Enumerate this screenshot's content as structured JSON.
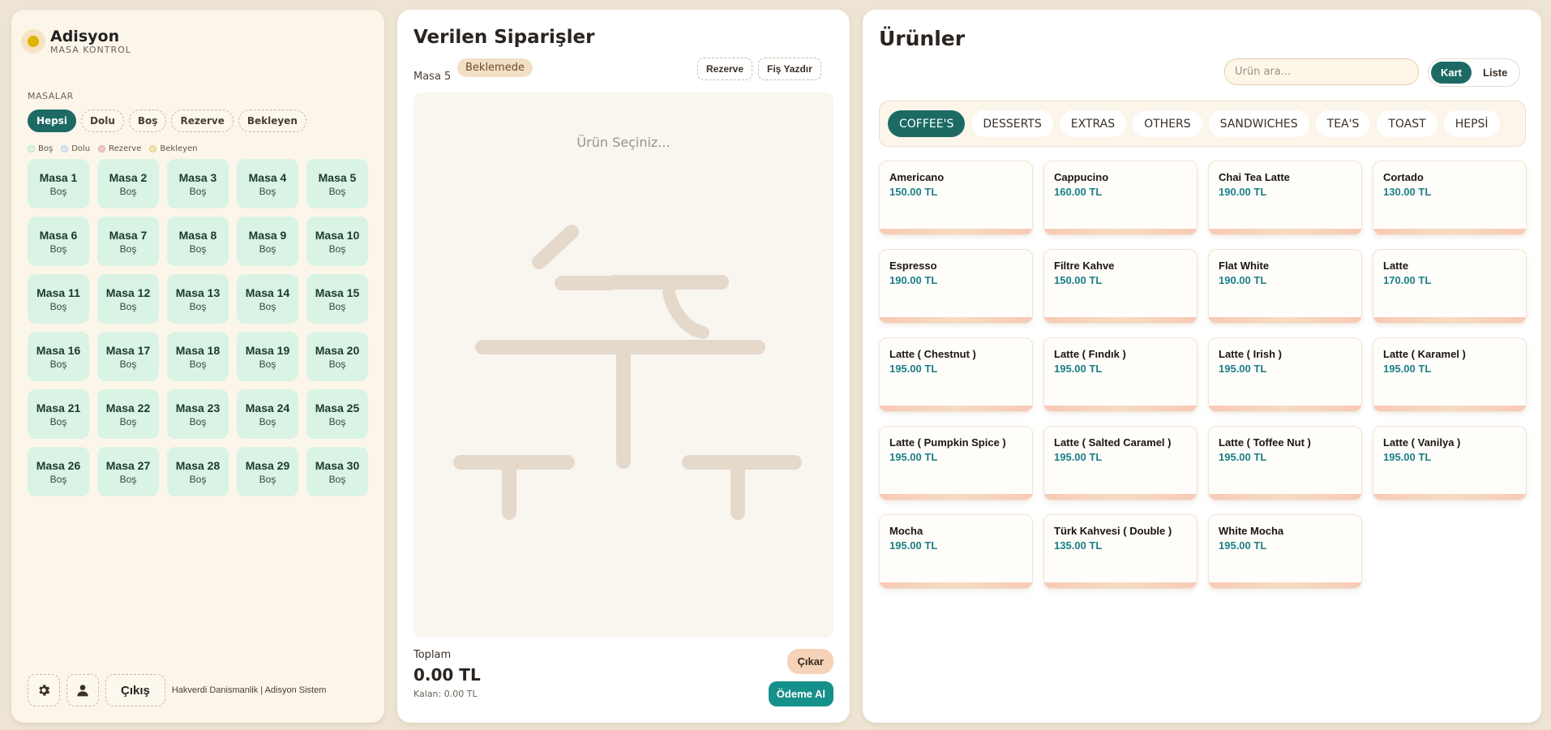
{
  "left": {
    "brand_title": "Adisyon",
    "brand_subtitle": "MASA KONTROL",
    "section_label": "MASALAR",
    "filters": [
      {
        "label": "Hepsi",
        "active": true
      },
      {
        "label": "Dolu",
        "active": false
      },
      {
        "label": "Boş",
        "active": false
      },
      {
        "label": "Rezerve",
        "active": false
      },
      {
        "label": "Bekleyen",
        "active": false
      }
    ],
    "legend": [
      {
        "label": "Boş",
        "color": "#d9f3e4"
      },
      {
        "label": "Dolu",
        "color": "#d6e8fb"
      },
      {
        "label": "Rezerve",
        "color": "#f6c7c7"
      },
      {
        "label": "Bekleyen",
        "color": "#f8e3a8"
      }
    ],
    "tables": [
      {
        "name": "Masa 1",
        "status": "Boş"
      },
      {
        "name": "Masa 2",
        "status": "Boş"
      },
      {
        "name": "Masa 3",
        "status": "Boş"
      },
      {
        "name": "Masa 4",
        "status": "Boş"
      },
      {
        "name": "Masa 5",
        "status": "Boş"
      },
      {
        "name": "Masa 6",
        "status": "Boş"
      },
      {
        "name": "Masa 7",
        "status": "Boş"
      },
      {
        "name": "Masa 8",
        "status": "Boş"
      },
      {
        "name": "Masa 9",
        "status": "Boş"
      },
      {
        "name": "Masa 10",
        "status": "Boş"
      },
      {
        "name": "Masa 11",
        "status": "Boş"
      },
      {
        "name": "Masa 12",
        "status": "Boş"
      },
      {
        "name": "Masa 13",
        "status": "Boş"
      },
      {
        "name": "Masa 14",
        "status": "Boş"
      },
      {
        "name": "Masa 15",
        "status": "Boş"
      },
      {
        "name": "Masa 16",
        "status": "Boş"
      },
      {
        "name": "Masa 17",
        "status": "Boş"
      },
      {
        "name": "Masa 18",
        "status": "Boş"
      },
      {
        "name": "Masa 19",
        "status": "Boş"
      },
      {
        "name": "Masa 20",
        "status": "Boş"
      },
      {
        "name": "Masa 21",
        "status": "Boş"
      },
      {
        "name": "Masa 22",
        "status": "Boş"
      },
      {
        "name": "Masa 23",
        "status": "Boş"
      },
      {
        "name": "Masa 24",
        "status": "Boş"
      },
      {
        "name": "Masa 25",
        "status": "Boş"
      },
      {
        "name": "Masa 26",
        "status": "Boş"
      },
      {
        "name": "Masa 27",
        "status": "Boş"
      },
      {
        "name": "Masa 28",
        "status": "Boş"
      },
      {
        "name": "Masa 29",
        "status": "Boş"
      },
      {
        "name": "Masa 30",
        "status": "Boş"
      }
    ],
    "footer": {
      "settings_icon": "gear-icon",
      "user_icon": "user-icon",
      "logout_label": "Çıkış",
      "credit": "Hakverdi Danismanlik | Adisyon Sistem"
    }
  },
  "order": {
    "title": "Verilen Siparişler",
    "table_label": "Masa 5",
    "status": "Beklemede",
    "reserve_label": "Rezerve",
    "print_label": "Fiş Yazdır",
    "empty_text": "Ürün Seçiniz...",
    "total_label": "Toplam",
    "total_value": "0.00 TL",
    "remaining": "Kalan: 0.00 TL",
    "remove_label": "Çıkar",
    "pay_label": "Ödeme Al"
  },
  "products": {
    "title": "Ürünler",
    "search_placeholder": "Ürün ara...",
    "view_options": [
      {
        "label": "Kart",
        "active": true
      },
      {
        "label": "Liste",
        "active": false
      }
    ],
    "categories": [
      {
        "label": "COFFEE'S",
        "active": true
      },
      {
        "label": "DESSERTS",
        "active": false
      },
      {
        "label": "EXTRAS",
        "active": false
      },
      {
        "label": "OTHERS",
        "active": false
      },
      {
        "label": "SANDWICHES",
        "active": false
      },
      {
        "label": "TEA'S",
        "active": false
      },
      {
        "label": "TOAST",
        "active": false
      },
      {
        "label": "HEPSİ",
        "active": false
      }
    ],
    "items": [
      {
        "name": "Americano",
        "price": "150.00 TL"
      },
      {
        "name": "Cappucino",
        "price": "160.00 TL"
      },
      {
        "name": "Chai Tea Latte",
        "price": "190.00 TL"
      },
      {
        "name": "Cortado",
        "price": "130.00 TL"
      },
      {
        "name": "Espresso",
        "price": "190.00 TL"
      },
      {
        "name": "Filtre Kahve",
        "price": "150.00 TL"
      },
      {
        "name": "Flat White",
        "price": "190.00 TL"
      },
      {
        "name": "Latte",
        "price": "170.00 TL"
      },
      {
        "name": "Latte ( Chestnut )",
        "price": "195.00 TL"
      },
      {
        "name": "Latte ( Fındık )",
        "price": "195.00 TL"
      },
      {
        "name": "Latte ( Irish )",
        "price": "195.00 TL"
      },
      {
        "name": "Latte ( Karamel )",
        "price": "195.00 TL"
      },
      {
        "name": "Latte ( Pumpkin Spice )",
        "price": "195.00 TL"
      },
      {
        "name": "Latte ( Salted Caramel )",
        "price": "195.00 TL"
      },
      {
        "name": "Latte ( Toffee Nut )",
        "price": "195.00 TL"
      },
      {
        "name": "Latte ( Vanilya )",
        "price": "195.00 TL"
      },
      {
        "name": "Mocha",
        "price": "195.00 TL"
      },
      {
        "name": "Türk Kahvesi ( Double )",
        "price": "135.00 TL"
      },
      {
        "name": "White Mocha",
        "price": "195.00 TL"
      }
    ]
  }
}
